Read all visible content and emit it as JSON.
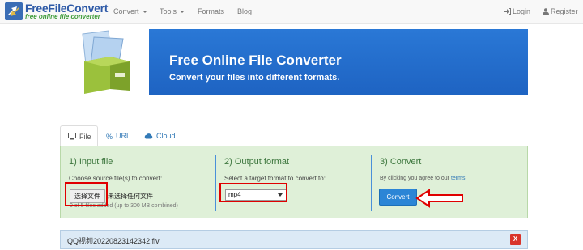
{
  "brand": {
    "title": "FreeFileConvert",
    "subtitle": "free online file converter",
    "colors": {
      "title": "#2e5aa7",
      "subtitle": "#3e9b3a",
      "accent": "#2b85d6",
      "annotation": "#e00000"
    }
  },
  "nav": {
    "items": [
      {
        "label": "Convert",
        "has_caret": true
      },
      {
        "label": "Tools",
        "has_caret": true
      },
      {
        "label": "Formats",
        "has_caret": false
      },
      {
        "label": "Blog",
        "has_caret": false
      }
    ],
    "login": "Login",
    "register": "Register",
    "login_icon": "login-icon",
    "register_icon": "user-icon"
  },
  "banner": {
    "title": "Free Online File Converter",
    "subtitle": "Convert your files into different formats."
  },
  "tabs": [
    {
      "label": "File",
      "icon": "monitor-icon",
      "active": true
    },
    {
      "label": "URL",
      "icon": "link-icon",
      "active": false
    },
    {
      "label": "Cloud",
      "icon": "cloud-icon",
      "active": false
    }
  ],
  "steps": {
    "input": {
      "title": "1) Input file",
      "description": "Choose source file(s) to convert:",
      "button_label": "选择文件",
      "no_file_label": "未选择任何文件",
      "files_added": "0 of 5 files added (up to 300 MB combined)"
    },
    "output": {
      "title": "2) Output format",
      "description": "Select a target format to convert to:",
      "selected_format": "mp4"
    },
    "convert": {
      "title": "3) Convert",
      "terms_prefix": "By clicking you agree to our ",
      "terms_link": "terms",
      "button_label": "Convert"
    }
  },
  "file_list": [
    {
      "name": "QQ视频20220823142342.flv",
      "remove_label": "X"
    }
  ]
}
